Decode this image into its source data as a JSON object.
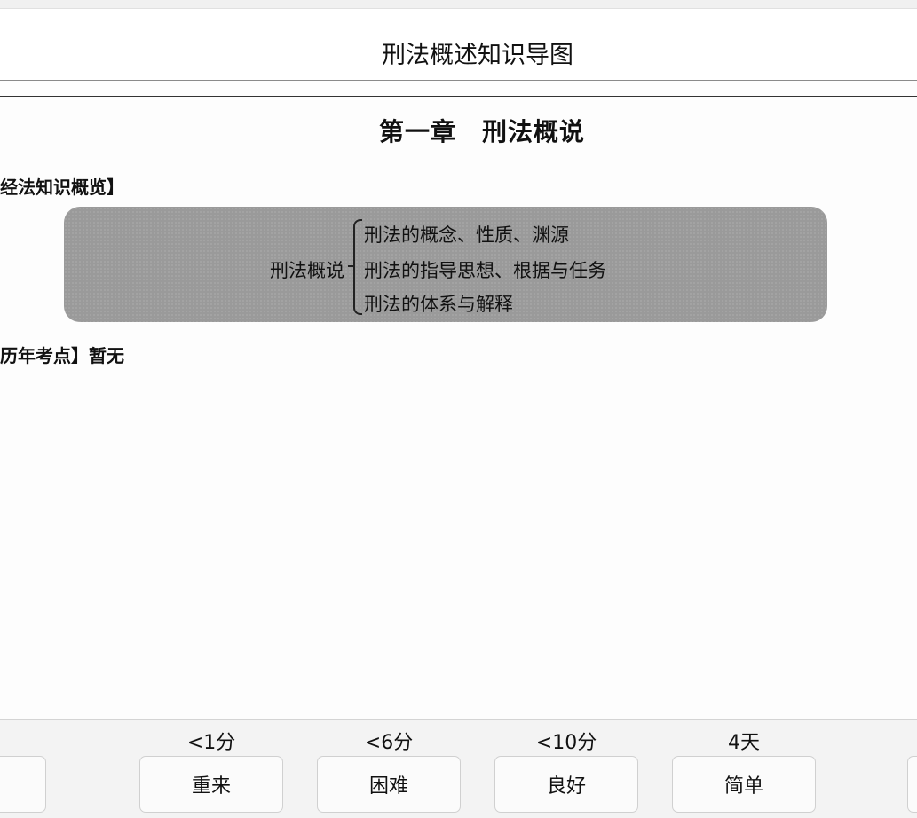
{
  "card": {
    "title": "刑法概述知识导图"
  },
  "scan": {
    "chapter": "第一章　刑法概说",
    "overview_heading": "经法知识概览】",
    "mindmap": {
      "root": "刑法概说",
      "items": [
        "刑法的概念、性质、渊源",
        "刑法的指导思想、根据与任务",
        "刑法的体系与解释"
      ]
    },
    "exam_points": "历年考点】暂无"
  },
  "answers": [
    {
      "interval": "<1分",
      "label": "重来"
    },
    {
      "interval": "<6分",
      "label": "困难"
    },
    {
      "interval": "<10分",
      "label": "良好"
    },
    {
      "interval": "4天",
      "label": "简单"
    }
  ]
}
